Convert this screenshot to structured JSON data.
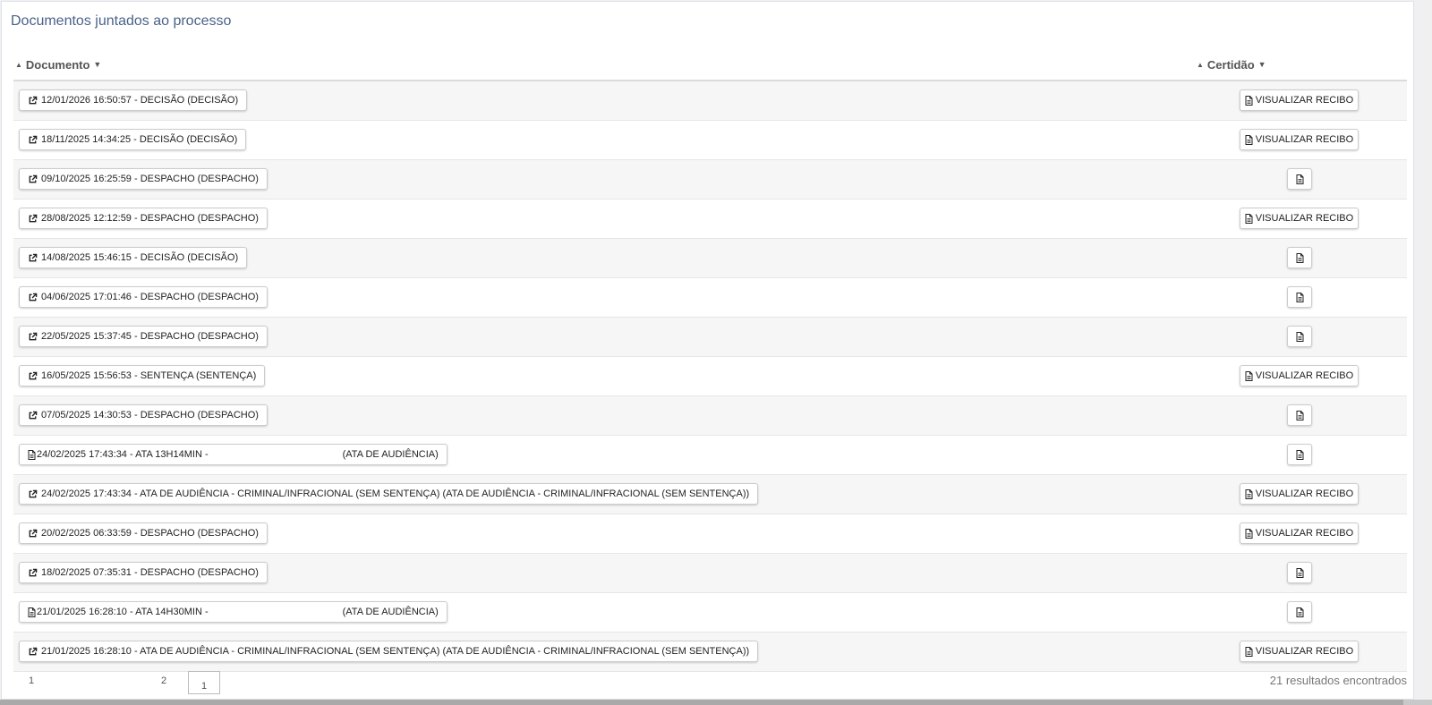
{
  "panel": {
    "title": "Documentos juntados ao processo"
  },
  "table": {
    "headers": {
      "documento": "Documento",
      "certidao": "Certidão"
    },
    "rows": [
      {
        "doc": "12/01/2026 16:50:57 - DECISÃO (DECISÃO)",
        "doc_icon": "external-link-icon",
        "cert": "VISUALIZAR RECIBO"
      },
      {
        "doc": "18/11/2025 14:34:25 - DECISÃO (DECISÃO)",
        "doc_icon": "external-link-icon",
        "cert": "VISUALIZAR RECIBO"
      },
      {
        "doc": "09/10/2025 16:25:59 - DESPACHO (DESPACHO)",
        "doc_icon": "external-link-icon",
        "cert": ""
      },
      {
        "doc": "28/08/2025 12:12:59 - DESPACHO (DESPACHO)",
        "doc_icon": "external-link-icon",
        "cert": "VISUALIZAR RECIBO"
      },
      {
        "doc": "14/08/2025 15:46:15 - DECISÃO (DECISÃO)",
        "doc_icon": "external-link-icon",
        "cert": ""
      },
      {
        "doc": "04/06/2025 17:01:46 - DESPACHO (DESPACHO)",
        "doc_icon": "external-link-icon",
        "cert": ""
      },
      {
        "doc": "22/05/2025 15:37:45 - DESPACHO (DESPACHO)",
        "doc_icon": "external-link-icon",
        "cert": ""
      },
      {
        "doc": "16/05/2025 15:56:53 - SENTENÇA (SENTENÇA)",
        "doc_icon": "external-link-icon",
        "cert": "VISUALIZAR RECIBO"
      },
      {
        "doc": "07/05/2025 14:30:53 - DESPACHO (DESPACHO)",
        "doc_icon": "external-link-icon",
        "cert": ""
      },
      {
        "doc": "24/02/2025 17:43:34 - ATA 13H14MIN -",
        "doc_suffix": "(ATA DE AUDIÊNCIA)",
        "doc_icon": "file-icon",
        "cert": ""
      },
      {
        "doc": "24/02/2025 17:43:34 - ATA DE AUDIÊNCIA - CRIMINAL/INFRACIONAL (SEM SENTENÇA) (ATA DE AUDIÊNCIA - CRIMINAL/INFRACIONAL (SEM SENTENÇA))",
        "doc_icon": "external-link-icon",
        "cert": "VISUALIZAR RECIBO"
      },
      {
        "doc": "20/02/2025 06:33:59 - DESPACHO (DESPACHO)",
        "doc_icon": "external-link-icon",
        "cert": "VISUALIZAR RECIBO"
      },
      {
        "doc": "18/02/2025 07:35:31 - DESPACHO (DESPACHO)",
        "doc_icon": "external-link-icon",
        "cert": ""
      },
      {
        "doc": "21/01/2025 16:28:10 - ATA 14H30MIN -",
        "doc_suffix": "(ATA DE AUDIÊNCIA)",
        "doc_icon": "file-icon",
        "cert": ""
      },
      {
        "doc": "21/01/2025 16:28:10 - ATA DE AUDIÊNCIA - CRIMINAL/INFRACIONAL (SEM SENTENÇA) (ATA DE AUDIÊNCIA - CRIMINAL/INFRACIONAL (SEM SENTENÇA))",
        "doc_icon": "external-link-icon",
        "cert": "VISUALIZAR RECIBO"
      }
    ]
  },
  "pagination": {
    "page1": "1",
    "page2": "2",
    "current": "1",
    "results": "21 resultados encontrados"
  },
  "colors": {
    "title": "#4a6389",
    "row_stripe": "#f6f6f6"
  }
}
